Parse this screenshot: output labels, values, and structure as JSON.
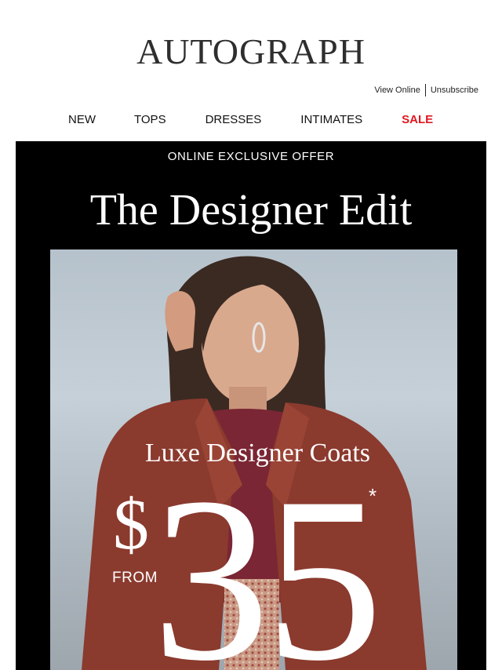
{
  "brand": {
    "logo_text": "AUTOGRAPH"
  },
  "utility": {
    "view_online": "View Online",
    "unsubscribe": "Unsubscribe"
  },
  "nav": {
    "items": [
      {
        "label": "NEW"
      },
      {
        "label": "TOPS"
      },
      {
        "label": "DRESSES"
      },
      {
        "label": "INTIMATES"
      },
      {
        "label": "SALE"
      }
    ],
    "sale_color": "#e0191f"
  },
  "hero": {
    "offer_label": "ONLINE EXCLUSIVE OFFER",
    "headline": "The Designer Edit",
    "coats_title": "Luxe Designer Coats",
    "currency": "$",
    "from_label": "FROM",
    "price": "35",
    "asterisk": "*",
    "background_color": "#000000",
    "coat_color": "#8b3a2e"
  }
}
